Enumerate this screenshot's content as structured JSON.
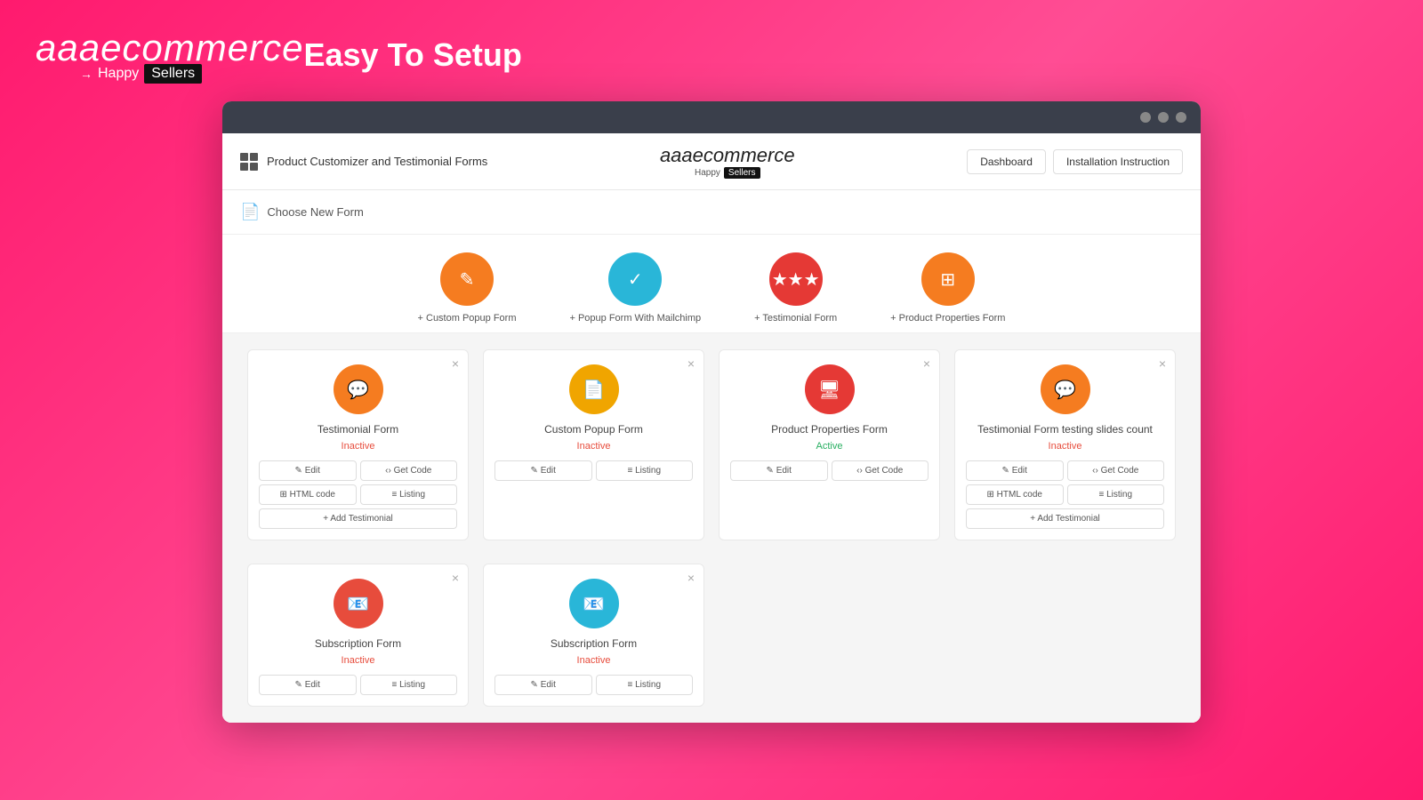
{
  "topBar": {
    "logo": {
      "prefix": "aaa",
      "italic": "ecommerce",
      "happy": "Happy",
      "sellers": "Sellers"
    },
    "heading": "Easy To Setup"
  },
  "app": {
    "headerTitle": "Product Customizer and Testimonial Forms",
    "logoPrefix": "aaa",
    "logoItalic": "ecommerce",
    "happyText": "Happy",
    "sellersText": "Sellers",
    "dashboardBtn": "Dashboard",
    "installBtn": "Installation Instruction",
    "chooseFormText": "Choose New Form"
  },
  "formTypes": [
    {
      "label": "+ Custom Popup Form",
      "iconColor": "icon-orange",
      "emoji": "✎"
    },
    {
      "label": "+ Popup Form With Mailchimp",
      "iconColor": "icon-blue",
      "emoji": "✓"
    },
    {
      "label": "+ Testimonial Form",
      "iconColor": "icon-red",
      "emoji": "★"
    },
    {
      "label": "+ Product Properties Form",
      "iconColor": "icon-orange",
      "emoji": "⊞"
    }
  ],
  "cards": [
    {
      "title": "Testimonial Form",
      "status": "Inactive",
      "statusClass": "status-inactive",
      "iconColor": "icon-testimonial",
      "emoji": "💬",
      "buttons": [
        {
          "label": "✎ Edit",
          "full": false
        },
        {
          "label": "‹› Get Code",
          "full": false
        },
        {
          "label": "⊞ HTML code",
          "full": false
        },
        {
          "label": "≡ Listing",
          "full": false
        },
        {
          "label": "+ Add Testimonial",
          "full": true
        }
      ]
    },
    {
      "title": "Custom Popup Form",
      "status": "Inactive",
      "statusClass": "status-inactive",
      "iconColor": "icon-custom",
      "emoji": "📄",
      "buttons": [
        {
          "label": "✎ Edit",
          "full": false
        },
        {
          "label": "≡ Listing",
          "full": false
        }
      ]
    },
    {
      "title": "Product Properties Form",
      "status": "Active",
      "statusClass": "status-active",
      "iconColor": "icon-product",
      "emoji": "🖥",
      "buttons": [
        {
          "label": "✎ Edit",
          "full": false
        },
        {
          "label": "‹› Get Code",
          "full": false
        }
      ]
    },
    {
      "title": "Testimonial Form testing slides count",
      "status": "Inactive",
      "statusClass": "status-inactive",
      "iconColor": "icon-testimonial",
      "emoji": "💬",
      "buttons": [
        {
          "label": "✎ Edit",
          "full": false
        },
        {
          "label": "‹› Get Code",
          "full": false
        },
        {
          "label": "⊞ HTML code",
          "full": false
        },
        {
          "label": "≡ Listing",
          "full": false
        },
        {
          "label": "+ Add Testimonial",
          "full": true
        }
      ]
    }
  ],
  "cards2": [
    {
      "title": "Subscription Form",
      "status": "Inactive",
      "statusClass": "status-inactive",
      "iconColor": "icon-subscription",
      "emoji": "📧",
      "buttons": [
        {
          "label": "✎ Edit",
          "full": false
        },
        {
          "label": "≡ Listing",
          "full": false
        }
      ]
    },
    {
      "title": "Subscription Form",
      "status": "Inactive",
      "statusClass": "status-inactive",
      "iconColor": "icon-subscription2",
      "emoji": "📧",
      "buttons": [
        {
          "label": "✎ Edit",
          "full": false
        },
        {
          "label": "≡ Listing",
          "full": false
        }
      ]
    }
  ],
  "browserDots": [
    "dot1",
    "dot2",
    "dot3"
  ]
}
